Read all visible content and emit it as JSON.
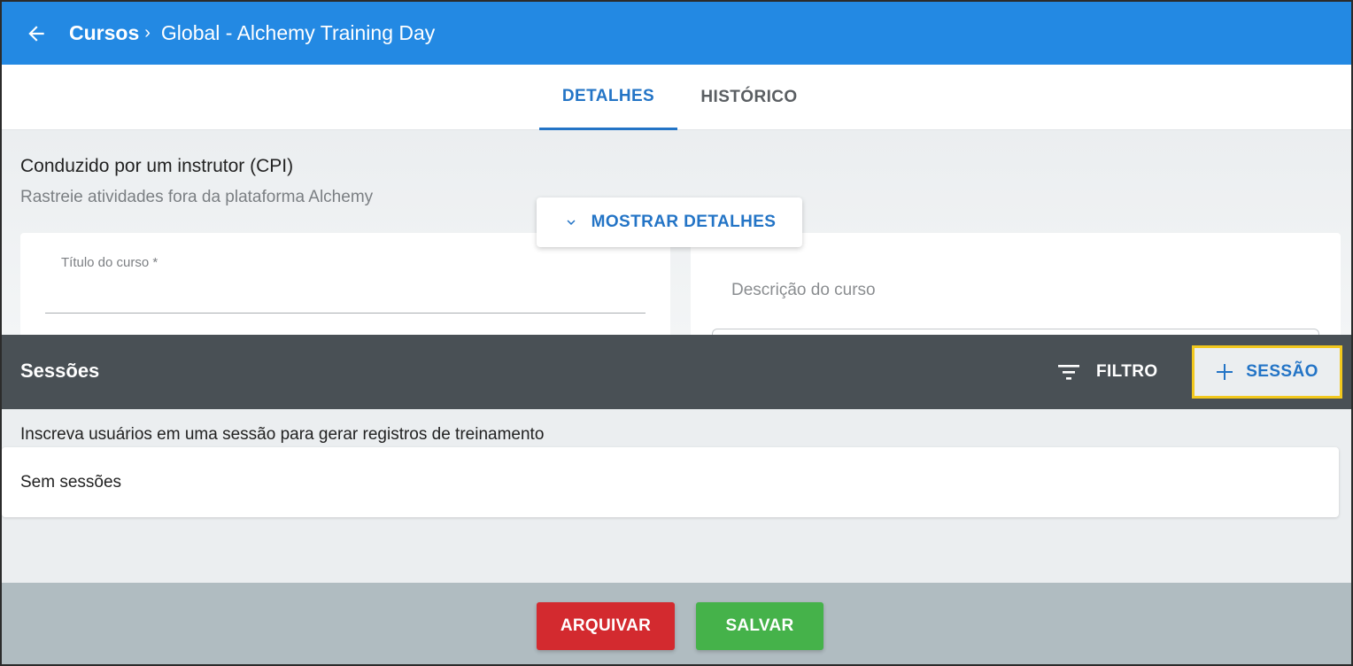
{
  "header": {
    "breadcrumb_root": "Cursos",
    "breadcrumb_separator": "›",
    "breadcrumb_current": "Global - Alchemy Training Day",
    "bg_color": "#2389e3"
  },
  "tabs": [
    {
      "label": "DETALHES",
      "active": true
    },
    {
      "label": "HISTÓRICO",
      "active": false
    }
  ],
  "details": {
    "type_title": "Conduzido por um instrutor (CPI)",
    "type_subtitle": "Rastreie atividades fora da plataforma Alchemy",
    "show_details_label": "MOSTRAR DETALHES",
    "course_title_label": "Título do curso *",
    "course_description_placeholder": "Descrição do curso"
  },
  "sessions": {
    "title": "Sessões",
    "filter_label": "FILTRO",
    "add_session_label": "SESSÃO",
    "help_text": "Inscreva usuários em uma sessão para gerar registros de treinamento",
    "empty_text": "Sem sessões",
    "bar_color": "#495055",
    "highlight_color": "#f2c81d"
  },
  "footer": {
    "archive_label": "ARQUIVAR",
    "save_label": "SALVAR",
    "archive_color": "#d32a2f",
    "save_color": "#45b24a"
  },
  "accent_color": "#2374c6"
}
